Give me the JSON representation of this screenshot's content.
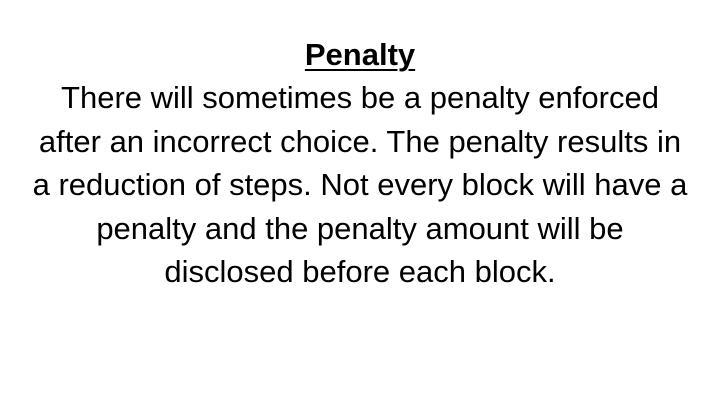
{
  "slide": {
    "title": "Penalty",
    "body": "There will sometimes be a penalty enforced after an incorrect choice. The penalty results in a reduction of steps. Not every block will have a penalty and the penalty amount will be disclosed before each block."
  }
}
